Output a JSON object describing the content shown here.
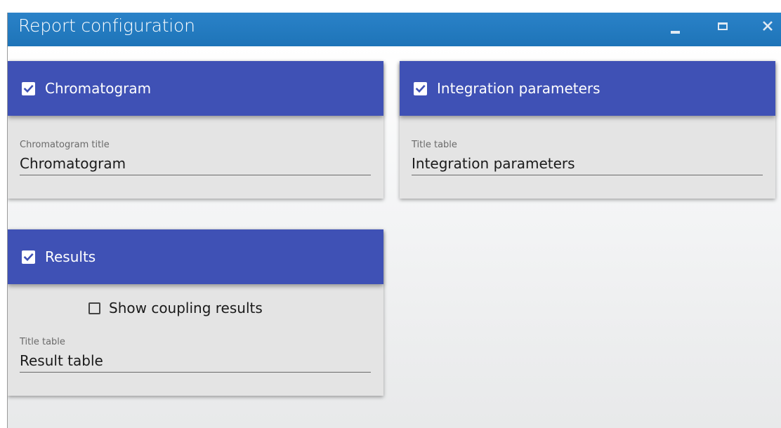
{
  "window": {
    "title": "Report configuration",
    "controls": [
      "minimize-icon",
      "maximize-icon",
      "close-icon"
    ]
  },
  "colors": {
    "titlebar": "#1e74b8",
    "card_header": "#3f51b5",
    "card_body": "#e4e4e4"
  },
  "sections": {
    "chromatogram": {
      "checked": true,
      "label": "Chromatogram",
      "field_caption": "Chromatogram title",
      "field_value": "Chromatogram"
    },
    "integration": {
      "checked": true,
      "label": "Integration parameters",
      "field_caption": "Title table",
      "field_value": "Integration parameters"
    },
    "results": {
      "checked": true,
      "label": "Results",
      "coupling_label": "Show coupling results",
      "coupling_checked": false,
      "field_caption": "Title table",
      "field_value": "Result table"
    }
  }
}
